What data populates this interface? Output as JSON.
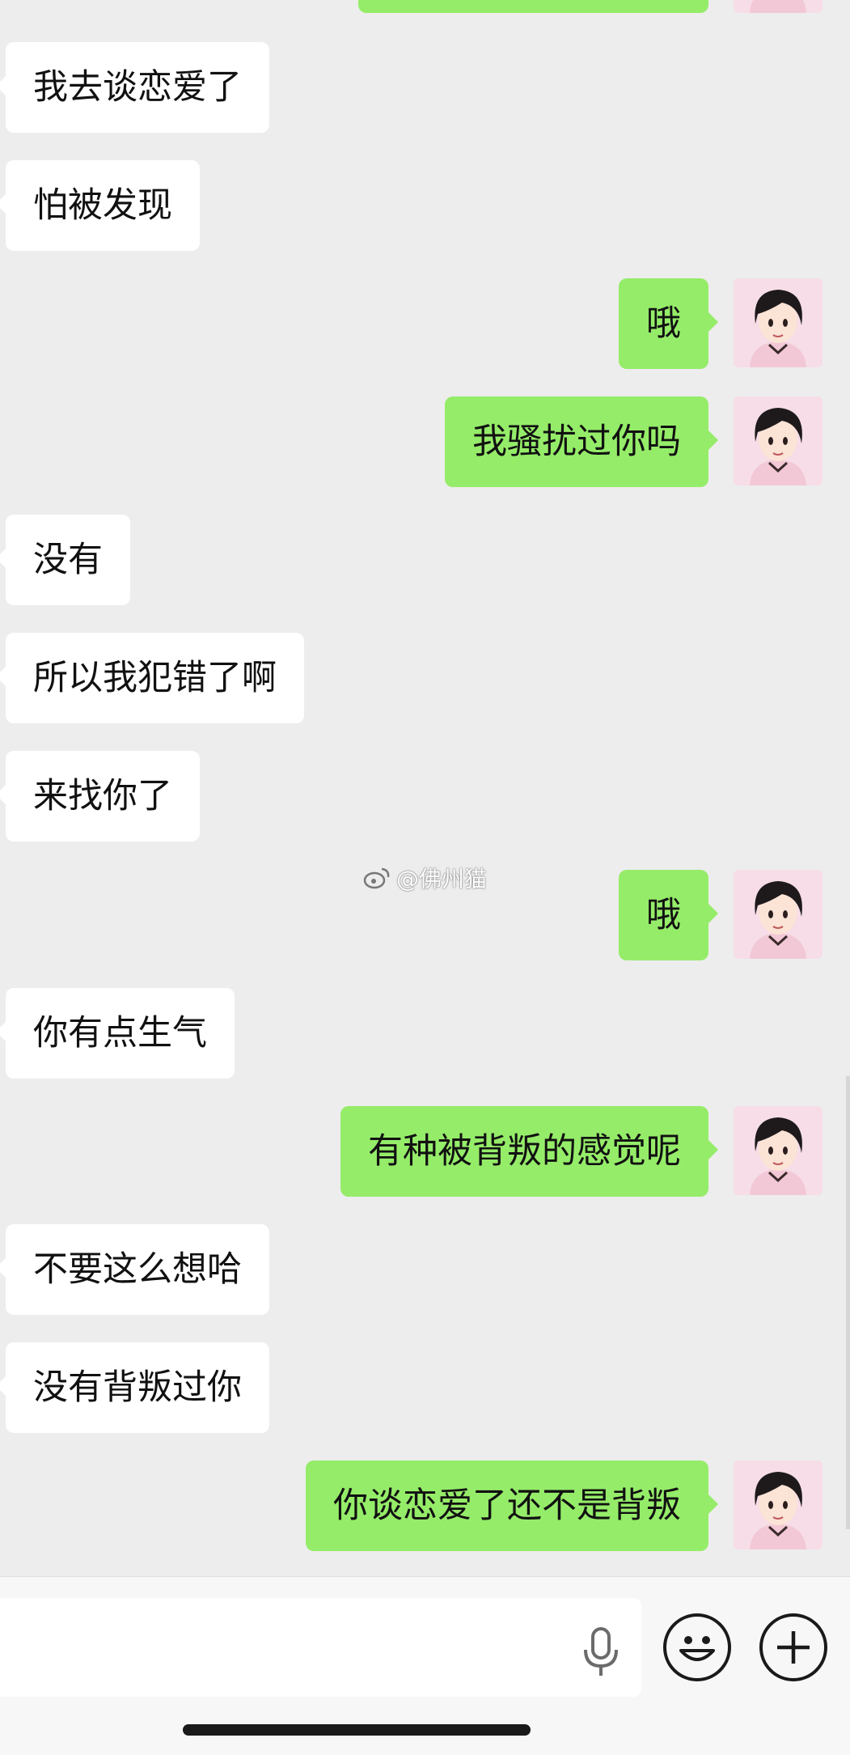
{
  "messages": [
    {
      "side": "right",
      "text": ""
    },
    {
      "side": "left",
      "text": "我去谈恋爱了"
    },
    {
      "side": "left",
      "text": "怕被发现"
    },
    {
      "side": "right",
      "text": "哦"
    },
    {
      "side": "right",
      "text": "我骚扰过你吗"
    },
    {
      "side": "left",
      "text": "没有"
    },
    {
      "side": "left",
      "text": "所以我犯错了啊"
    },
    {
      "side": "left",
      "text": "来找你了"
    },
    {
      "side": "right",
      "text": "哦"
    },
    {
      "side": "left",
      "text": "你有点生气"
    },
    {
      "side": "right",
      "text": "有种被背叛的感觉呢"
    },
    {
      "side": "left",
      "text": "不要这么想哈"
    },
    {
      "side": "left",
      "text": "没有背叛过你"
    },
    {
      "side": "right",
      "text": "你谈恋爱了还不是背叛"
    }
  ],
  "watermark": {
    "text": "@佛州猫",
    "icon": "weibo-icon"
  },
  "input": {
    "value": "",
    "placeholder": ""
  },
  "icons": {
    "voice": "microphone-icon",
    "emoji": "emoji-icon",
    "more": "plus-icon"
  },
  "colors": {
    "background": "#ededed",
    "sent_bubble": "#95ec69",
    "received_bubble": "#ffffff"
  }
}
